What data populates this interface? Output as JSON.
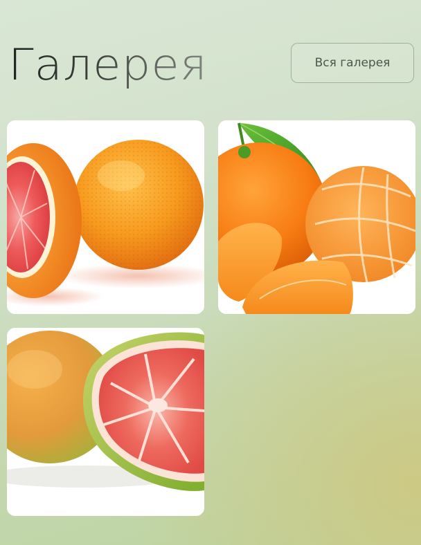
{
  "header": {
    "title": "Галерея",
    "all_gallery_button": "Вся галерея"
  },
  "gallery": {
    "images": [
      {
        "subject": "grapefruit-halved-and-whole"
      },
      {
        "subject": "tangerine-whole-and-peeled-with-leaves"
      },
      {
        "subject": "pomelo-cut-open"
      }
    ]
  },
  "colors": {
    "background_light": "#d9e6d5",
    "background_warm": "#cdc882",
    "title_dark": "#1f231f",
    "button_border": "#8ca087",
    "button_text": "#4e554c"
  }
}
